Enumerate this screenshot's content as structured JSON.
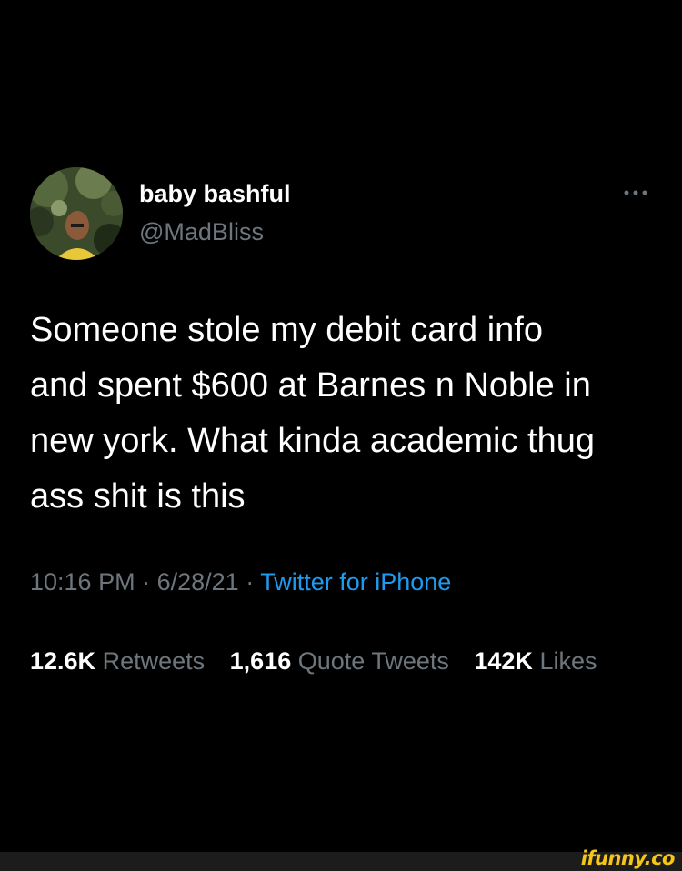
{
  "tweet": {
    "display_name": "baby bashful",
    "handle": "@MadBliss",
    "text_lines": [
      "Someone stole my debit card info",
      "and spent $600 at Barnes n Noble in",
      "new york. What kinda academic thug",
      "ass shit is this"
    ],
    "time": "10:16 PM",
    "date": "6/28/21",
    "separator": "·",
    "source": "Twitter for iPhone",
    "stats": {
      "retweets_count": "12.6K",
      "retweets_label": "Retweets",
      "quotes_count": "1,616",
      "quotes_label": "Quote Tweets",
      "likes_count": "142K",
      "likes_label": "Likes"
    }
  },
  "watermark": "ifunny.co",
  "icons": {
    "more": "more-horizontal-icon",
    "avatar": "user-avatar"
  },
  "colors": {
    "background": "#000000",
    "text_primary": "#ffffff",
    "text_secondary": "#6e767d",
    "link": "#1d9bf0",
    "divider": "#2f3336",
    "watermark": "#f5c518"
  }
}
